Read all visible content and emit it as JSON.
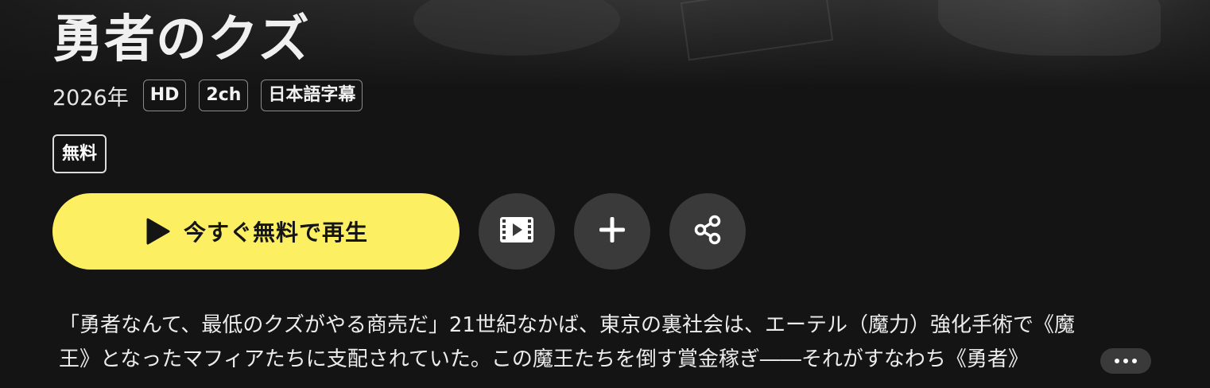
{
  "title": "勇者のクズ",
  "meta": {
    "year": "2026年",
    "tags": [
      "HD",
      "2ch",
      "日本語字幕"
    ]
  },
  "badge": {
    "free": "無料"
  },
  "actions": {
    "play_label": "今すぐ無料で再生",
    "play_icon": "play-icon",
    "trailer_icon": "film-icon",
    "add_icon": "plus-icon",
    "share_icon": "share-icon",
    "accent_color": "#fcf062"
  },
  "synopsis": {
    "line1": "「勇者なんて、最低のクズがやる商売だ」21世紀なかば、東京の裏社会は、エーテル（魔力）強化手術で《魔",
    "line2": "王》となったマフィアたちに支配されていた。この魔王たちを倒す賞金稼ぎ――それがすなわち《勇者》",
    "more_icon": "ellipsis-icon"
  }
}
